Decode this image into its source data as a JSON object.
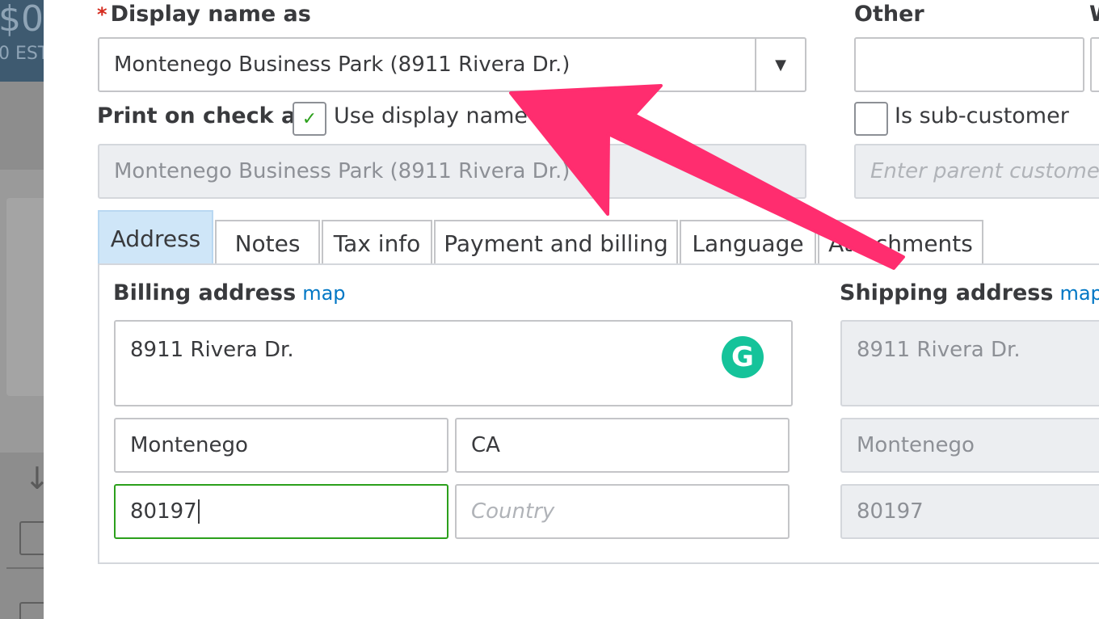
{
  "background": {
    "amount": "$0",
    "est_label": "0 EST"
  },
  "form": {
    "display_name": {
      "label": "Display name as",
      "required_mark": "*",
      "value": "Montenego Business Park (8911 Rivera Dr.)",
      "dropdown_icon": "caret-down-icon"
    },
    "other": {
      "label": "Other",
      "value": "",
      "next_label_fragment": "W"
    },
    "print_on_check": {
      "label": "Print on check as",
      "use_display_name_label": "Use display name",
      "use_display_name_checked": true,
      "value": "Montenego Business Park (8911 Rivera Dr.)"
    },
    "sub_customer": {
      "label": "Is sub-customer",
      "checked": false,
      "parent_placeholder": "Enter parent custome"
    }
  },
  "tabs": [
    {
      "label": "Address",
      "active": true
    },
    {
      "label": "Notes",
      "active": false
    },
    {
      "label": "Tax info",
      "active": false
    },
    {
      "label": "Payment and billing",
      "active": false
    },
    {
      "label": "Language",
      "active": false
    },
    {
      "label": "Attachments",
      "active": false
    }
  ],
  "billing": {
    "heading": "Billing address",
    "map_link": "map",
    "street": "8911 Rivera Dr.",
    "city": "Montenego",
    "state": "CA",
    "zip": "80197",
    "country_placeholder": "Country"
  },
  "shipping": {
    "heading": "Shipping address",
    "map_link": "map",
    "street": "8911 Rivera Dr.",
    "city": "Montenego",
    "zip": "80197"
  },
  "annotation": {
    "arrow_color": "#ff2d6f"
  },
  "colors": {
    "accent_green": "#2ca01c",
    "link_blue": "#0077c5",
    "grammarly_green": "#15c39a",
    "required_red": "#d52b1e"
  }
}
